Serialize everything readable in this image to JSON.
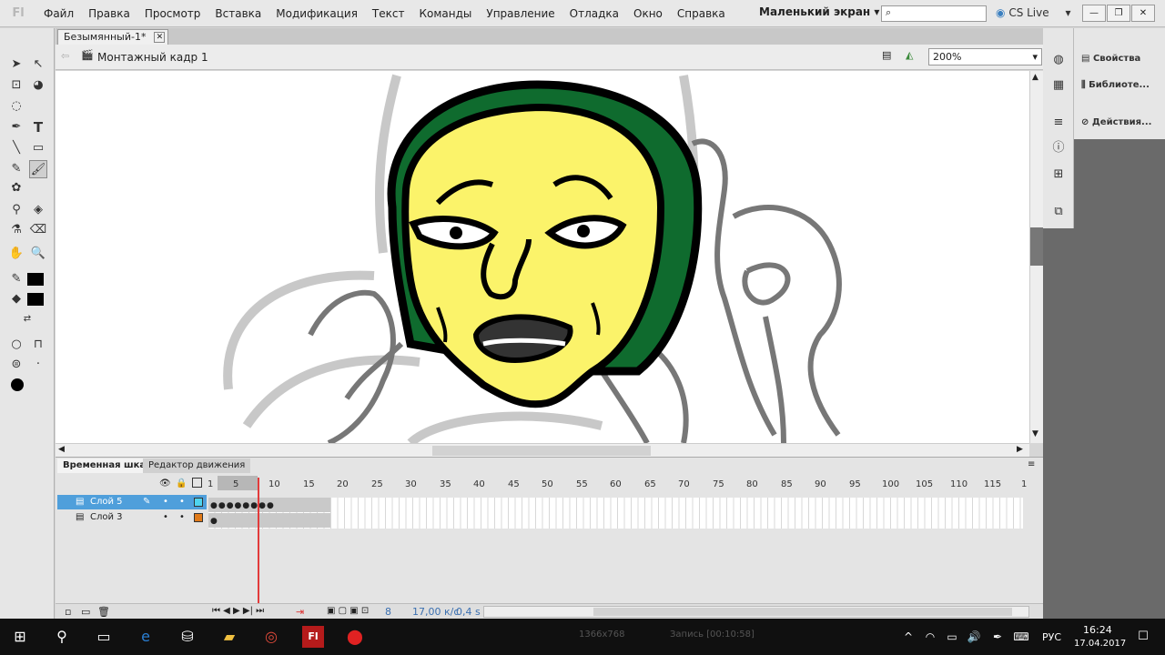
{
  "app": {
    "logo": "Fl",
    "workspace": "Маленький экран",
    "cs_live": "CS Live"
  },
  "menu": [
    "Файл",
    "Правка",
    "Просмотр",
    "Вставка",
    "Модификация",
    "Текст",
    "Команды",
    "Управление",
    "Отладка",
    "Окно",
    "Справка"
  ],
  "document": {
    "tab": "Безымянный-1*",
    "scene": "Монтажный кадр 1",
    "zoom": "200%"
  },
  "panels": [
    "Свойства",
    "Библиоте...",
    "Действия..."
  ],
  "timeline": {
    "tabs": [
      "Временная шкала",
      "Редактор движения"
    ],
    "ruler": [
      "1",
      "5",
      "10",
      "15",
      "20",
      "25",
      "30",
      "35",
      "40",
      "45",
      "50",
      "55",
      "60",
      "65",
      "70",
      "75",
      "80",
      "85",
      "90",
      "95",
      "100",
      "105",
      "110",
      "115",
      "1"
    ],
    "layers": [
      {
        "name": "Слой 5",
        "color": "#4fd4ee",
        "selected": true
      },
      {
        "name": "Слой 3",
        "color": "#e07a1a",
        "selected": false
      }
    ],
    "status": {
      "frame": "8",
      "fps": "17,00 к/с",
      "time": "0,4 s"
    }
  },
  "taskbar": {
    "lang": "РУС",
    "time": "16:24",
    "date": "17.04.2017",
    "rec": "Запись [00:10:58]",
    "res": "1366x768"
  },
  "colors": {
    "accent_blue": "#4f9fdb",
    "stage_bg": "#ffffff",
    "playhead": "#e23b3b",
    "face": "#fbf36a",
    "hood": "#0f6b2e"
  }
}
